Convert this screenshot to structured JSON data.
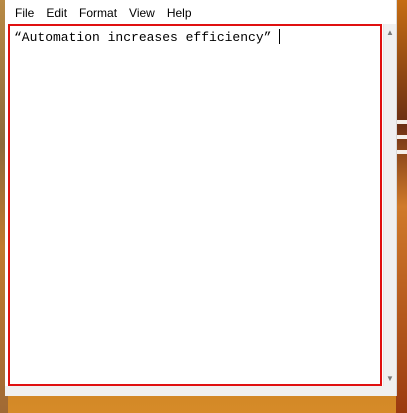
{
  "menu": {
    "items": [
      {
        "label": "File"
      },
      {
        "label": "Edit"
      },
      {
        "label": "Format"
      },
      {
        "label": "View"
      },
      {
        "label": "Help"
      }
    ]
  },
  "editor": {
    "text": "“Automation increases efficiency”",
    "highlight_color": "#e01010"
  },
  "scrollbar": {
    "up_icon": "chevron-up-icon",
    "down_icon": "chevron-down-icon"
  }
}
